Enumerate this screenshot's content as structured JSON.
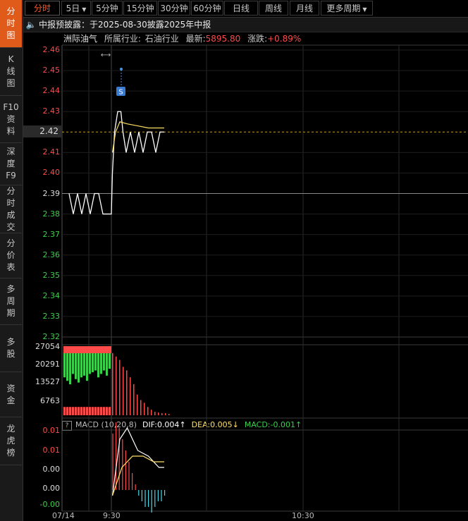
{
  "sidebar": {
    "items": [
      {
        "label": "分时图",
        "lines": [
          "分",
          "时",
          "图"
        ],
        "active": true
      },
      {
        "label": "K线图",
        "lines": [
          "K",
          "线",
          "图"
        ],
        "active": false
      },
      {
        "label": "F10资料",
        "lines": [
          "F10",
          "资",
          "料"
        ],
        "active": false
      },
      {
        "label": "深度F9",
        "lines": [
          "深",
          "度",
          "F9"
        ],
        "active": false
      },
      {
        "label": "分时成交",
        "lines": [
          "分",
          "时",
          "成",
          "交"
        ],
        "active": false
      },
      {
        "label": "分价表",
        "lines": [
          "分",
          "价",
          "表"
        ],
        "active": false
      },
      {
        "label": "多周期",
        "lines": [
          "多",
          "周",
          "期"
        ],
        "active": false
      },
      {
        "label": "多股",
        "lines": [
          "多",
          "股"
        ],
        "active": false
      },
      {
        "label": "资金",
        "lines": [
          "资",
          "金"
        ],
        "active": false
      },
      {
        "label": "龙虎榜",
        "lines": [
          "龙",
          "虎",
          "榜"
        ],
        "active": false
      }
    ]
  },
  "toolbar": {
    "tabs": [
      {
        "label": "分时",
        "active": true
      },
      {
        "label": "5日",
        "dropdown": true
      },
      {
        "label": "5分钟"
      },
      {
        "label": "15分钟"
      },
      {
        "label": "30分钟"
      },
      {
        "label": "60分钟"
      },
      {
        "label": "日线"
      },
      {
        "label": "周线"
      },
      {
        "label": "月线"
      },
      {
        "label": "更多周期",
        "dropdown": true
      }
    ]
  },
  "notice": {
    "text": "中报预披露：于2025-08-30披露2025年中报"
  },
  "info": {
    "stock_name": "洲际油气",
    "industry_label": "所属行业:",
    "industry": "石油行业",
    "latest_label": "最新:",
    "latest": "5895.80",
    "change_label": "涨跌:",
    "change": "+0.89%"
  },
  "price_axis": {
    "labels": [
      "2.46",
      "2.45",
      "2.44",
      "2.43",
      "2.41",
      "2.40",
      "2.39",
      "2.38",
      "2.37",
      "2.36",
      "2.35",
      "2.34",
      "2.33",
      "2.32"
    ],
    "current": "2.42"
  },
  "volume_axis": {
    "labels": [
      "27054",
      "20291",
      "13527",
      "6763"
    ]
  },
  "macd": {
    "help": "?",
    "title": "MACD (10,20,8)",
    "dif": "DIF:0.004",
    "dea": "DEA:0.005",
    "macd": "MACD:-0.001",
    "axis_labels": [
      "0.01",
      "0.01",
      "0.00",
      "0.00",
      "-0.00"
    ]
  },
  "x_axis": {
    "labels": [
      "07/14",
      "9:30",
      "10:30"
    ]
  },
  "marker": {
    "label": "S"
  },
  "colors": {
    "up": "#ff4a4a",
    "down": "#3ad04a",
    "accent": "#e05a1a",
    "avg": "#ffe066",
    "cyan": "#4ad8e8"
  },
  "chart_data": {
    "type": "line",
    "price_series": {
      "points": [
        [
          -4.0,
          2.39
        ],
        [
          -3.6,
          2.38
        ],
        [
          -3.2,
          2.39
        ],
        [
          -2.8,
          2.38
        ],
        [
          -2.4,
          2.39
        ],
        [
          -2.0,
          2.38
        ],
        [
          -1.6,
          2.39
        ],
        [
          -1.2,
          2.39
        ],
        [
          -0.8,
          2.38
        ],
        [
          -0.4,
          2.38
        ],
        [
          0,
          2.38
        ],
        [
          0.1,
          2.4
        ],
        [
          0.3,
          2.42
        ],
        [
          0.6,
          2.43
        ],
        [
          0.9,
          2.43
        ],
        [
          1.1,
          2.42
        ],
        [
          1.4,
          2.41
        ],
        [
          1.8,
          2.42
        ],
        [
          2.2,
          2.41
        ],
        [
          2.6,
          2.42
        ],
        [
          3.0,
          2.41
        ],
        [
          3.4,
          2.42
        ],
        [
          3.8,
          2.42
        ],
        [
          4.2,
          2.41
        ],
        [
          4.6,
          2.42
        ],
        [
          5.0,
          2.42
        ]
      ]
    },
    "avg_series": {
      "points": [
        [
          0.1,
          2.41
        ],
        [
          0.4,
          2.42
        ],
        [
          0.8,
          2.425
        ],
        [
          1.5,
          2.424
        ],
        [
          2.5,
          2.423
        ],
        [
          3.5,
          2.422
        ],
        [
          5.0,
          2.422
        ]
      ]
    },
    "volume_up": [
      0.9,
      0.85,
      0.8,
      0.7,
      0.65,
      0.55,
      0.45,
      0.3,
      0.22,
      0.18,
      0.12,
      0.08,
      0.05,
      0.04,
      0.03,
      0.03,
      0.02
    ],
    "volume_down_before_open": [
      0.7,
      0.8,
      0.9,
      0.6,
      0.75,
      0.85,
      0.7,
      0.65,
      0.8,
      0.6,
      0.55,
      0.5,
      0.7,
      0.6,
      0.5,
      0.65,
      0.45
    ],
    "macd_dif": [
      [
        0.1,
        -0.001
      ],
      [
        0.8,
        0.009
      ],
      [
        1.5,
        0.011
      ],
      [
        2.5,
        0.007
      ],
      [
        3.5,
        0.006
      ],
      [
        4.5,
        0.004
      ],
      [
        5.0,
        0.004
      ]
    ],
    "macd_dea": [
      [
        0.1,
        -0.001
      ],
      [
        1.0,
        0.004
      ],
      [
        2.0,
        0.006
      ],
      [
        3.0,
        0.006
      ],
      [
        4.0,
        0.005
      ],
      [
        5.0,
        0.005
      ]
    ],
    "macd_hist": [
      0.01,
      0.012,
      0.011,
      0.009,
      0.007,
      0.005,
      0.003,
      0.001,
      -0.001,
      -0.002,
      -0.003,
      -0.003,
      -0.004,
      -0.003,
      -0.002,
      -0.002,
      -0.001
    ]
  }
}
